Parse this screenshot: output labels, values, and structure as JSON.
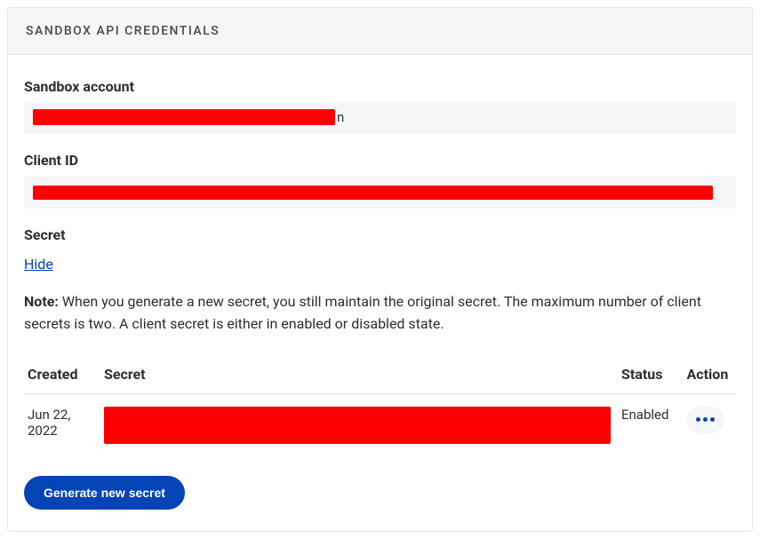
{
  "header": {
    "title": "SANDBOX API CREDENTIALS"
  },
  "fields": {
    "sandbox_account_label": "Sandbox account",
    "sandbox_account_trail": "n",
    "client_id_label": "Client ID",
    "secret_label": "Secret",
    "hide_link": "Hide"
  },
  "note": {
    "prefix": "Note:",
    "text": " When you generate a new secret, you still maintain the original secret. The maximum number of client secrets is two. A client secret is either in enabled or disabled state."
  },
  "table": {
    "headers": {
      "created": "Created",
      "secret": "Secret",
      "status": "Status",
      "action": "Action"
    },
    "rows": [
      {
        "created": "Jun 22, 2022",
        "status": "Enabled"
      }
    ]
  },
  "buttons": {
    "generate": "Generate new secret"
  }
}
